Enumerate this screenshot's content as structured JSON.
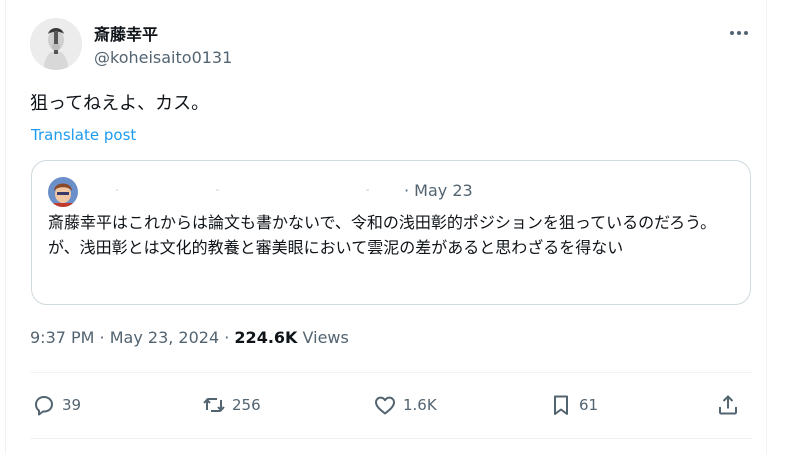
{
  "author": {
    "display_name": "斎藤幸平",
    "handle": "@koheisaito0131"
  },
  "tweet": {
    "text": "狙ってねえよ、カス。",
    "translate_label": "Translate post"
  },
  "quoted": {
    "date": "· May 23",
    "text": "斎藤幸平はこれからは論文も書かないで、令和の浅田彰的ポジションを狙っているのだろう。が、浅田彰とは文化的教養と審美眼において雲泥の差があると思わざるを得ない"
  },
  "meta": {
    "time": "9:37 PM",
    "sep1": " · ",
    "date": "May 23, 2024",
    "sep2": " · ",
    "views_count": "224.6K",
    "views_label": " Views"
  },
  "actions": {
    "replies": "39",
    "reposts": "256",
    "likes": "1.6K",
    "bookmarks": "61"
  },
  "colors": {
    "accent": "#1d9bf0",
    "secondary_text": "#536471",
    "border": "#cfd9de"
  }
}
